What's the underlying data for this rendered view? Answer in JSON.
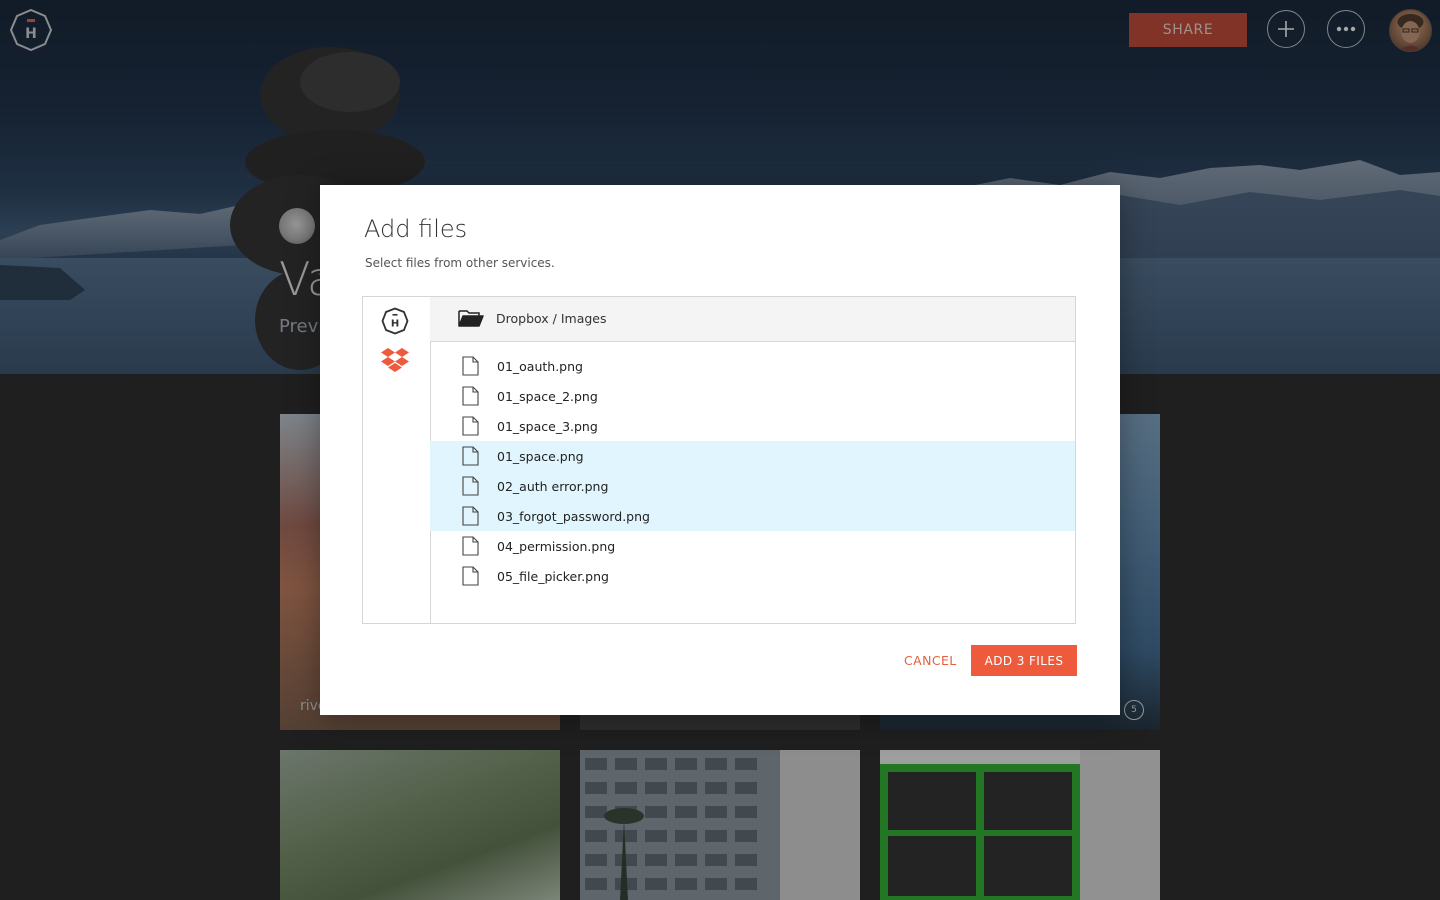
{
  "header": {
    "share_label": "SHARE",
    "add_icon": "plus-icon",
    "more_icon": "more-horizontal-icon",
    "logo_letter": "H"
  },
  "page": {
    "title_fragment": "Va",
    "subtitle_fragment": "Previ",
    "cards": [
      {
        "label": "rive",
        "comments": ""
      },
      {
        "label": "",
        "comments": ""
      },
      {
        "label": "",
        "comments": "5"
      }
    ]
  },
  "modal": {
    "title": "Add files",
    "subtitle": "Select files from other services.",
    "services": [
      {
        "name": "hightail-service",
        "letter": "H"
      },
      {
        "name": "dropbox-service"
      }
    ],
    "path": "Dropbox / Images",
    "files": [
      {
        "name": "01_oauth.png",
        "selected": false
      },
      {
        "name": "01_space_2.png",
        "selected": false
      },
      {
        "name": "01_space_3.png",
        "selected": false
      },
      {
        "name": "01_space.png",
        "selected": true
      },
      {
        "name": "02_auth error.png",
        "selected": true
      },
      {
        "name": "03_forgot_password.png",
        "selected": true
      },
      {
        "name": "04_permission.png",
        "selected": false
      },
      {
        "name": "05_file_picker.png",
        "selected": false
      }
    ],
    "cancel_label": "CANCEL",
    "add_label": "ADD 3 FILES"
  },
  "colors": {
    "accent": "#ee5a3c",
    "share": "#c0452f",
    "selected_row": "#e0f5fd"
  }
}
